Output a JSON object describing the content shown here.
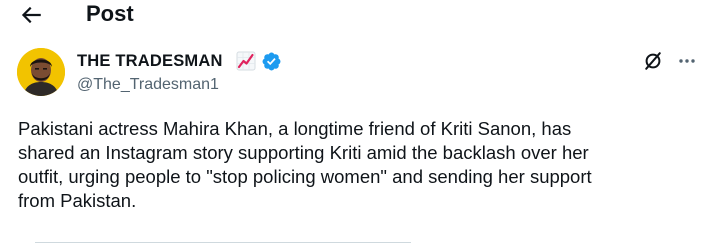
{
  "header": {
    "back_icon": "arrow-left-icon",
    "title": "Post"
  },
  "tweet": {
    "author": {
      "name": "THE TRADESMAN",
      "handle": "@The_Tradesman1",
      "name_emoji": "chart-increasing-icon",
      "verified": true,
      "verified_color": "#1d9bf0"
    },
    "actions": {
      "grok_icon": "grok-icon",
      "more_icon": "more-horizontal-icon"
    },
    "text": "Pakistani actress Mahira Khan, a longtime friend of Kriti Sanon, has\nshared an Instagram story supporting Kriti amid the backlash over her\noutfit, urging people to \"stop policing women\" and sending her support\nfrom Pakistan."
  },
  "colors": {
    "text_primary": "#0f1419",
    "text_secondary": "#536471",
    "avatar_background": "#f2c300"
  }
}
